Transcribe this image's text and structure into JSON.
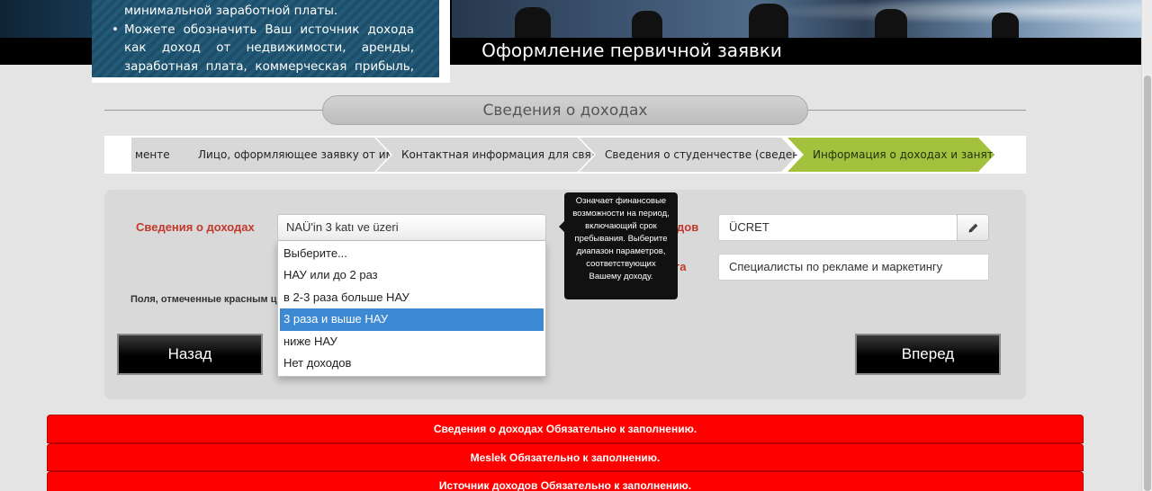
{
  "banner": {
    "title": "Оформление первичной заявки"
  },
  "infobox": {
    "line1": "минимальной заработной платы.",
    "bullet": "Можете обозначить Ваш источник дохода как доход от недвижимости, аренды, заработная плата, коммерческая прибыль, наследство, сбережения и"
  },
  "section": {
    "title": "Сведения о доходах"
  },
  "steps": [
    {
      "label": "менте"
    },
    {
      "label": "Лицо, оформляющее заявку от имени и"
    },
    {
      "label": "Контактная информация для связи в Турции"
    },
    {
      "label": "Сведения о студенчестве (сведения о те"
    },
    {
      "label": "Информация о доходах и занятости"
    }
  ],
  "form": {
    "income_label": "Сведения о доходах",
    "income_value": "NAÜ'in 3 katı ve üzeri",
    "income_options": [
      "Выберите...",
      "НАУ или до 2 раз",
      "в 2-3 раза больше НАУ",
      "3 раза и выше НАУ",
      "ниже НАУ",
      "Нет доходов"
    ],
    "income_selected_index": 3,
    "source_label_partial": "дов",
    "source_value": "ÜCRET",
    "job_label_partial": "абота",
    "job_value": "Специалисты по рекламе и маркетингу",
    "hint": "Поля, отмеченные красным цв",
    "tooltip": "Означает финансовые возможности на период, включающий срок пребывания. Выберите диапазон параметров, соответствующих Вашему доходу."
  },
  "nav": {
    "back": "Назад",
    "next": "Вперед"
  },
  "errors": [
    "Сведения о доходах Обязательно к заполнению.",
    "Meslek Обязательно к заполнению.",
    "Источник доходов Обязательно к заполнению."
  ],
  "colors": {
    "accent_step": "#a2c23e",
    "error_bg": "#ff0000",
    "label_red": "#c0392b",
    "dropdown_selected": "#3d89d3"
  },
  "icons": {
    "edit": "pencil-icon"
  }
}
